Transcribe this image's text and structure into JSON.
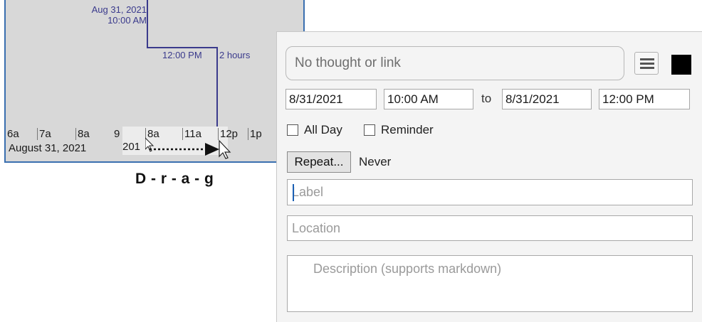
{
  "timeline": {
    "start_date": "Aug 31, 2021",
    "start_time": "10:00 AM",
    "end_time": "12:00 PM",
    "duration": "2 hours",
    "hours": [
      "6a",
      "7a",
      "8a",
      "9",
      "8a",
      "11a",
      "12p",
      "1p"
    ],
    "day_label": "August 31, 2021",
    "year_fragment": "201",
    "accent_color": "#3a3a8c"
  },
  "drag_hint": "D - r - a - g",
  "editor": {
    "thought_placeholder": "No thought or link",
    "menu_icon": "hamburger-icon",
    "color": "#000000",
    "start_date": "8/31/2021",
    "start_time": "10:00 AM",
    "to_label": "to",
    "end_date": "8/31/2021",
    "end_time": "12:00 PM",
    "all_day_label": "All Day",
    "reminder_label": "Reminder",
    "repeat_button": "Repeat...",
    "repeat_value": "Never",
    "label_placeholder": "Label",
    "location_placeholder": "Location",
    "description_placeholder": "Description (supports markdown)"
  }
}
